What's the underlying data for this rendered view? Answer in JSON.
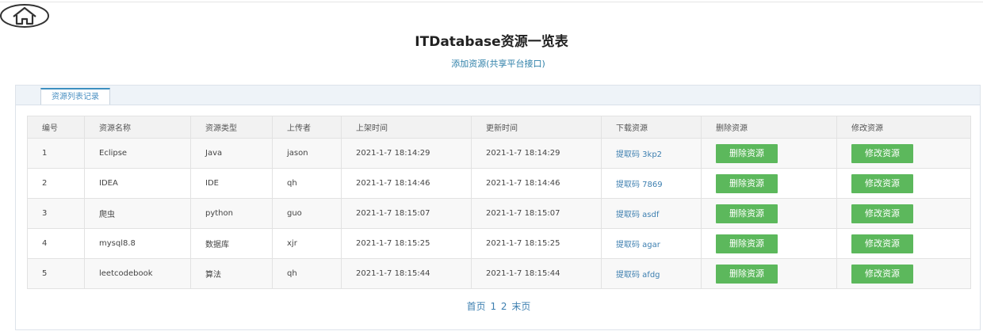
{
  "page": {
    "title": "ITDatabase资源一览表",
    "add_link": "添加资源(共享平台接口)"
  },
  "tab": {
    "label": "资源列表记录"
  },
  "table": {
    "headers": [
      "编号",
      "资源名称",
      "资源类型",
      "上传者",
      "上架时间",
      "更新时间",
      "下载资源",
      "删除资源",
      "修改资源"
    ],
    "rows": [
      {
        "id": "1",
        "name": "Eclipse",
        "type": "Java",
        "uploader": "jason",
        "listed": "2021-1-7 18:14:29",
        "updated": "2021-1-7 18:14:29",
        "download": "提取码 3kp2",
        "delete": "删除资源",
        "edit": "修改资源"
      },
      {
        "id": "2",
        "name": "IDEA",
        "type": "IDE",
        "uploader": "qh",
        "listed": "2021-1-7 18:14:46",
        "updated": "2021-1-7 18:14:46",
        "download": "提取码 7869",
        "delete": "删除资源",
        "edit": "修改资源"
      },
      {
        "id": "3",
        "name": "爬虫",
        "type": "python",
        "uploader": "guo",
        "listed": "2021-1-7 18:15:07",
        "updated": "2021-1-7 18:15:07",
        "download": "提取码 asdf",
        "delete": "删除资源",
        "edit": "修改资源"
      },
      {
        "id": "4",
        "name": "mysql8.8",
        "type": "数据库",
        "uploader": "xjr",
        "listed": "2021-1-7 18:15:25",
        "updated": "2021-1-7 18:15:25",
        "download": "提取码 agar",
        "delete": "删除资源",
        "edit": "修改资源"
      },
      {
        "id": "5",
        "name": "leetcodebook",
        "type": "算法",
        "uploader": "qh",
        "listed": "2021-1-7 18:15:44",
        "updated": "2021-1-7 18:15:44",
        "download": "提取码 afdg",
        "delete": "删除资源",
        "edit": "修改资源"
      }
    ]
  },
  "pagination": {
    "first": "首页",
    "pages": [
      "1",
      "2"
    ],
    "last": "末页"
  },
  "icons": {
    "home": "home-icon"
  },
  "colors": {
    "button": "#5cb85c",
    "link": "#3d7fb0",
    "tab_accent": "#3d8fc0"
  }
}
